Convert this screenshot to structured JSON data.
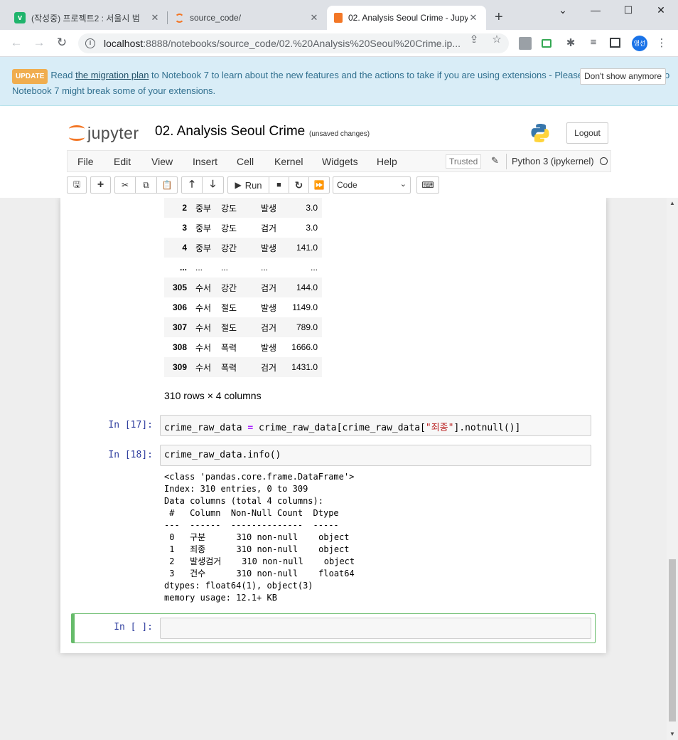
{
  "browser": {
    "tabs": [
      {
        "title": "(작성중) 프로젝트2 : 서울시 범",
        "icon": "vrew-v-icon"
      },
      {
        "title": "source_code/",
        "icon": "jupyter-icon"
      },
      {
        "title": "02. Analysis Seoul Crime - Jupy",
        "icon": "notebook-icon",
        "active": true
      }
    ],
    "url_host": "localhost",
    "url_path": ":8888/notebooks/source_code/02.%20Analysis%20Seoul%20Crime.ip...",
    "profile_label": "영선"
  },
  "banner": {
    "badge": "UPDATE",
    "text_before": "Read ",
    "link": "the migration plan",
    "text_after": " to Notebook 7 to learn about the new features and the actions to take if you are using extensions - Please note that updating to Notebook 7 might break some of your extensions.",
    "dismiss_label": "Don't show anymore"
  },
  "header": {
    "logo_text": "jupyter",
    "notebook_name": "02. Analysis Seoul Crime",
    "save_status": "(unsaved changes)",
    "logout_label": "Logout"
  },
  "menubar": {
    "items": [
      "File",
      "Edit",
      "View",
      "Insert",
      "Cell",
      "Kernel",
      "Widgets",
      "Help"
    ],
    "trusted": "Trusted",
    "kernel": "Python 3 (ipykernel)"
  },
  "toolbar": {
    "run_label": "Run",
    "cell_type": "Code"
  },
  "dataframe": {
    "rows": [
      [
        "2",
        "중부",
        "강도",
        "발생",
        "3.0"
      ],
      [
        "3",
        "중부",
        "강도",
        "검거",
        "3.0"
      ],
      [
        "4",
        "중부",
        "강간",
        "발생",
        "141.0"
      ],
      [
        "...",
        "...",
        "...",
        "...",
        "..."
      ],
      [
        "305",
        "수서",
        "강간",
        "검거",
        "144.0"
      ],
      [
        "306",
        "수서",
        "절도",
        "발생",
        "1149.0"
      ],
      [
        "307",
        "수서",
        "절도",
        "검거",
        "789.0"
      ],
      [
        "308",
        "수서",
        "폭력",
        "발생",
        "1666.0"
      ],
      [
        "309",
        "수서",
        "폭력",
        "검거",
        "1431.0"
      ]
    ],
    "shape_text": "310 rows × 4 columns"
  },
  "cells": [
    {
      "prompt": "In [17]:",
      "code_a": "crime_raw_data ",
      "code_op": "=",
      "code_b": " crime_raw_data[crime_raw_data[",
      "code_str": "\"죄종\"",
      "code_c": "].notnull()]"
    },
    {
      "prompt": "In [18]:",
      "code": "crime_raw_data.info()"
    },
    {
      "prompt": "In [ ]:",
      "code": ""
    }
  ],
  "info_output": "<class 'pandas.core.frame.DataFrame'>\nIndex: 310 entries, 0 to 309\nData columns (total 4 columns):\n #   Column  Non-Null Count  Dtype  \n---  ------  --------------  -----  \n 0   구분      310 non-null    object \n 1   죄종      310 non-null    object \n 2   발생검거    310 non-null    object \n 3   건수      310 non-null    float64\ndtypes: float64(1), object(3)\nmemory usage: 12.1+ KB"
}
